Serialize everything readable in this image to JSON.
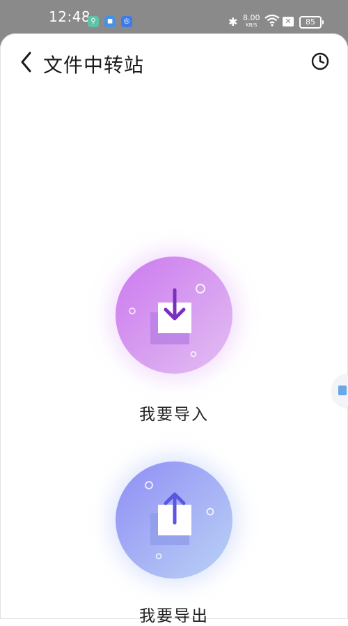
{
  "status_bar": {
    "time": "12:48",
    "speed_value": "8.00",
    "speed_unit": "KB/S",
    "battery": "85",
    "icons": [
      "app-icon-green",
      "app-icon-blue",
      "app-icon-chat",
      "bluetooth-icon",
      "wifi-icon",
      "x-icon",
      "battery-icon"
    ]
  },
  "header": {
    "back_icon": "chevron-left-icon",
    "title": "文件中转站",
    "history_icon": "clock-icon"
  },
  "actions": {
    "import_label": "我要导入",
    "export_label": "我要导出",
    "import_icon": "download-tray-icon",
    "export_icon": "upload-tray-icon",
    "colors": {
      "import_gradient": [
        "#cc78ef",
        "#e3bff4"
      ],
      "export_gradient": [
        "#8f8df5",
        "#b9d2f6"
      ],
      "arrow_import": "#7b2fbf",
      "arrow_export": "#5a56e0"
    }
  }
}
